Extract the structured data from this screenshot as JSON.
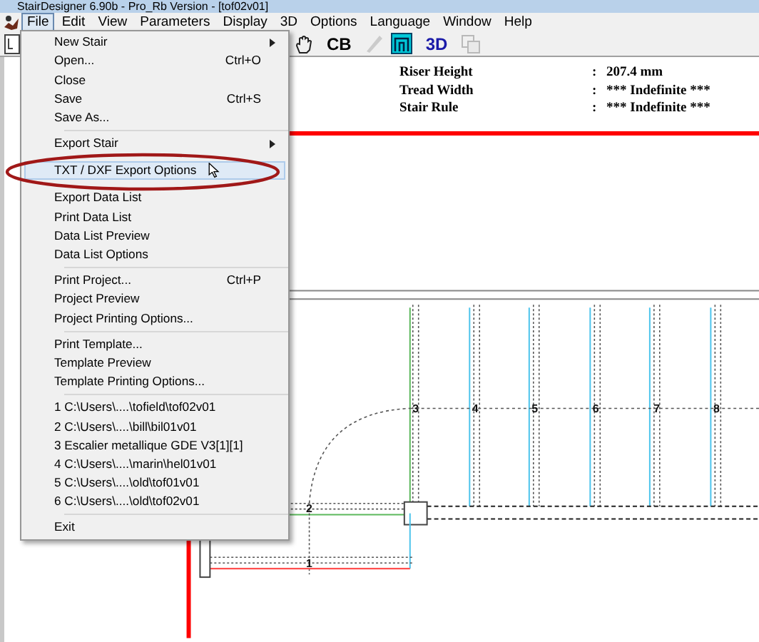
{
  "window": {
    "title": "StairDesigner 6.90b - Pro_Rb Version - [tof02v01]"
  },
  "menubar": [
    {
      "label": "File",
      "selected": true
    },
    {
      "label": "Edit",
      "selected": false
    },
    {
      "label": "View",
      "selected": false
    },
    {
      "label": "Parameters",
      "selected": false
    },
    {
      "label": "Display",
      "selected": false
    },
    {
      "label": "3D",
      "selected": false
    },
    {
      "label": "Options",
      "selected": false
    },
    {
      "label": "Language",
      "selected": false
    },
    {
      "label": "Window",
      "selected": false
    },
    {
      "label": "Help",
      "selected": false
    }
  ],
  "toolbar": [
    {
      "kind": "icon"
    },
    {
      "kind": "text",
      "label": "CB"
    },
    {
      "kind": "icon",
      "disabled": true
    },
    {
      "kind": "icon"
    },
    {
      "kind": "text",
      "label": "3D"
    },
    {
      "kind": "icon",
      "disabled": true
    }
  ],
  "file_menu": [
    {
      "kind": "item",
      "label": "New Stair",
      "submenu": true,
      "selected": false
    },
    {
      "kind": "item",
      "label": "Open...",
      "shortcut": "Ctrl+O",
      "selected": false
    },
    {
      "kind": "item",
      "label": "Close",
      "selected": false
    },
    {
      "kind": "item",
      "label": "Save",
      "shortcut": "Ctrl+S",
      "selected": false
    },
    {
      "kind": "item",
      "label": "Save As...",
      "selected": false
    },
    {
      "kind": "separator"
    },
    {
      "kind": "item",
      "label": "Export Stair",
      "submenu": true,
      "selected": false
    },
    {
      "kind": "item",
      "label": "TXT / DXF Export Options",
      "selected": true
    },
    {
      "kind": "item",
      "label": "Export Data List",
      "selected": false
    },
    {
      "kind": "item",
      "label": "Print Data List",
      "selected": false
    },
    {
      "kind": "item",
      "label": "Data List Preview",
      "selected": false
    },
    {
      "kind": "item",
      "label": "Data List Options",
      "selected": false
    },
    {
      "kind": "separator"
    },
    {
      "kind": "item",
      "label": "Print Project...",
      "shortcut": "Ctrl+P",
      "selected": false
    },
    {
      "kind": "item",
      "label": "Project Preview",
      "selected": false
    },
    {
      "kind": "item",
      "label": "Project Printing Options...",
      "selected": false
    },
    {
      "kind": "separator"
    },
    {
      "kind": "item",
      "label": "Print Template...",
      "selected": false
    },
    {
      "kind": "item",
      "label": "Template Preview",
      "selected": false
    },
    {
      "kind": "item",
      "label": "Template Printing Options...",
      "selected": false
    },
    {
      "kind": "separator"
    },
    {
      "kind": "item",
      "label": "1 C:\\Users\\....\\tofield\\tof02v01",
      "selected": false
    },
    {
      "kind": "item",
      "label": "2 C:\\Users\\....\\bill\\bil01v01",
      "selected": false
    },
    {
      "kind": "item",
      "label": "3 Escalier metallique GDE V3[1][1]",
      "selected": false
    },
    {
      "kind": "item",
      "label": "4 C:\\Users\\....\\marin\\hel01v01",
      "selected": false
    },
    {
      "kind": "item",
      "label": "5 C:\\Users\\....\\old\\tof01v01",
      "selected": false
    },
    {
      "kind": "item",
      "label": "6 C:\\Users\\....\\old\\tof02v01",
      "selected": false
    },
    {
      "kind": "separator"
    },
    {
      "kind": "item",
      "label": "Exit",
      "selected": false
    }
  ],
  "info": [
    {
      "label": "Riser Height",
      "colon": ":",
      "value": "207.4 mm"
    },
    {
      "label": "Tread Width",
      "colon": ":",
      "value": "*** Indefinite ***"
    },
    {
      "label": "Stair Rule",
      "colon": ":",
      "value": "*** Indefinite ***"
    }
  ],
  "drawing": {
    "step_numbers": [
      "1",
      "2",
      "3",
      "4",
      "5",
      "6",
      "7",
      "8"
    ]
  }
}
